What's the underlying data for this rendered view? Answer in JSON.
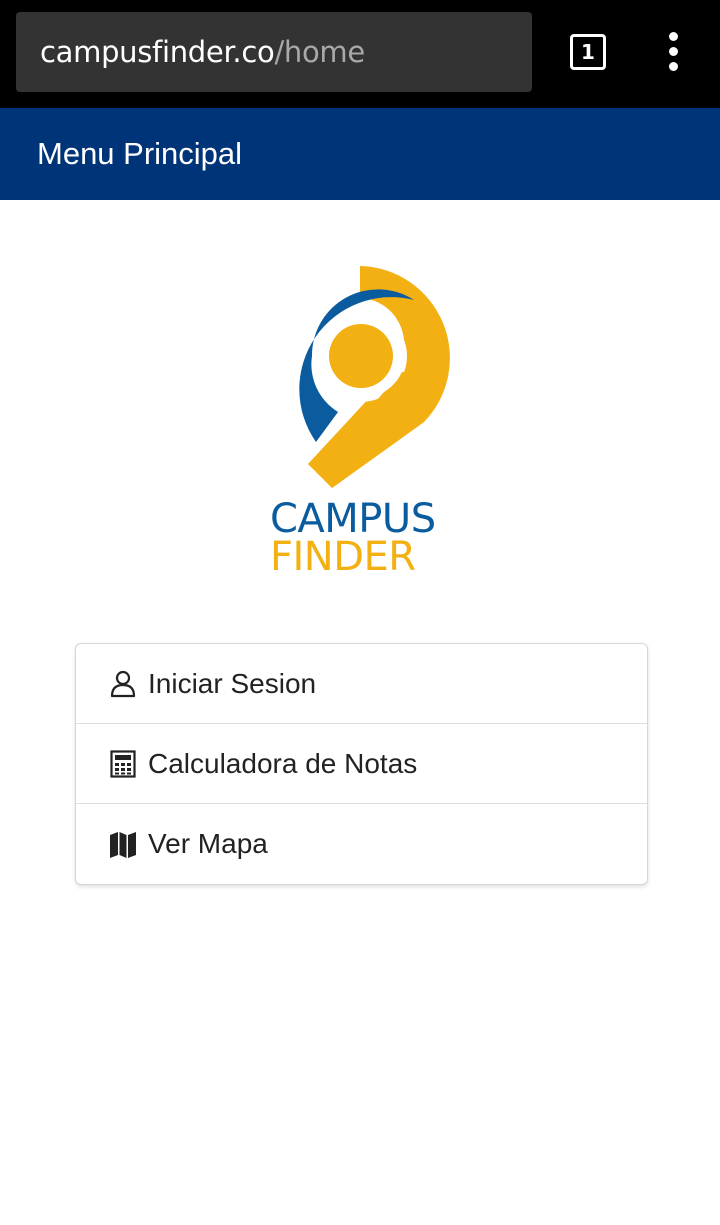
{
  "browser": {
    "url_host": "campusfinder.co",
    "url_path": "/home",
    "tab_count": "1",
    "menu_icon": "more-vert-icon"
  },
  "header": {
    "title": "Menu Principal"
  },
  "logo": {
    "line1": "CAMPUS",
    "line2": "FINDER",
    "colors": {
      "blue": "#0b5b9f",
      "yellow": "#f3b012"
    }
  },
  "menu": {
    "items": [
      {
        "label": "Iniciar Sesion",
        "icon": "user-icon"
      },
      {
        "label": "Calculadora de Notas",
        "icon": "calculator-icon"
      },
      {
        "label": "Ver Mapa",
        "icon": "map-icon"
      }
    ]
  },
  "colors": {
    "header_bg": "#003478",
    "browser_bg": "#000000",
    "url_box_bg": "#333333"
  }
}
